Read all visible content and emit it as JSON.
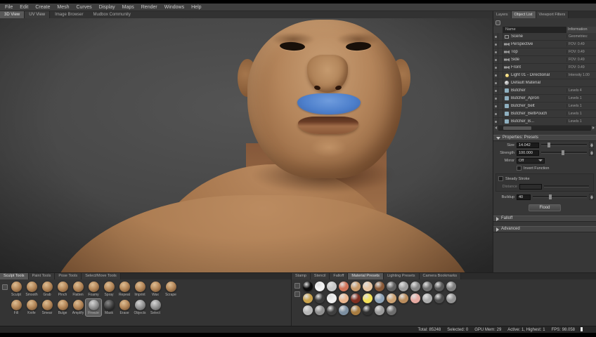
{
  "menu_bar": {
    "items": [
      "File",
      "Edit",
      "Create",
      "Mesh",
      "Curves",
      "Display",
      "Maps",
      "Render",
      "Windows",
      "Help"
    ]
  },
  "view_bar": {
    "tabs": [
      "3D View",
      "UV View"
    ],
    "links": [
      "Image Browser",
      "Mudbox Community"
    ]
  },
  "object_panel": {
    "tabs": [
      "Layers",
      "Object List",
      "Viewport Filters"
    ],
    "active_tab": "Object List",
    "header": {
      "name": "Name",
      "info": "Information"
    },
    "rows": [
      {
        "icon": "scene-icon",
        "name": "Scene",
        "info": "Geometries:"
      },
      {
        "icon": "camera-icon",
        "name": "Perspective",
        "info": "FOV: 0.49"
      },
      {
        "icon": "camera-icon",
        "name": "Top",
        "info": "FOV: 0.49"
      },
      {
        "icon": "camera-icon",
        "name": "Side",
        "info": "FOV: 0.49"
      },
      {
        "icon": "camera-icon",
        "name": "Front",
        "info": "FOV: 0.49"
      },
      {
        "icon": "light-icon",
        "name": "Light 01 - Directional",
        "info": "Intensity 1.00"
      },
      {
        "icon": "material-icon",
        "name": "Default Material",
        "info": ""
      },
      {
        "icon": "mesh-icon",
        "name": "Butcher",
        "info": "Levels 4"
      },
      {
        "icon": "mesh-icon",
        "name": "Butcher_Apron",
        "info": "Levels 1"
      },
      {
        "icon": "mesh-icon",
        "name": "Butcher_belt",
        "info": "Levels 1"
      },
      {
        "icon": "mesh-icon",
        "name": "Butcher_BeltPouch",
        "info": "Levels 1"
      },
      {
        "icon": "mesh-icon",
        "name": "Butcher_B...",
        "info": "Levels 1"
      }
    ]
  },
  "properties": {
    "title": "Properties: Presets",
    "size_label": "Size",
    "size_value": "14.042",
    "strength_label": "Strength",
    "strength_value": "100.000",
    "mirror_label": "Mirror",
    "mirror_value": "Off",
    "invert_label": "Invert Function",
    "steady_label": "Steady Stroke",
    "distance_label": "Distance",
    "distance_value": "",
    "buildup_label": "Buildup",
    "buildup_value": "40",
    "flood_label": "Flood",
    "falloff_label": "Falloff",
    "advanced_label": "Advanced"
  },
  "tool_tray": {
    "tabs": [
      "Sculpt Tools",
      "Paint Tools",
      "Pose Tools",
      "Select/Move Tools"
    ],
    "active_tab": "Sculpt Tools",
    "row1": [
      "Sculpt",
      "Smooth",
      "Grab",
      "Pinch",
      "Flatten",
      "Foamy",
      "Spray",
      "Repeat",
      "Imprint",
      "Wax",
      "Scrape"
    ],
    "row2": [
      "Fill",
      "Knife",
      "Smear",
      "Bulge",
      "Amplify",
      "Freeze",
      "Mask",
      "Erase",
      "Objects",
      "Select"
    ],
    "selected_tool": "Freeze"
  },
  "preset_tray": {
    "tabs": [
      "Stamp",
      "Stencil",
      "Falloff",
      "Material Presets",
      "Lighting Presets",
      "Camera Bookmarks"
    ],
    "active_tab": "Material Presets",
    "swatch_rows": [
      [
        "#0c0c0c",
        "#f2f2f2",
        "#c9c9c9",
        "#cf7258",
        "#c79a6a",
        "#e7c5a3",
        "#8a5a38",
        "#5f5f5f",
        "#9d9d9d",
        "#868686",
        "#707070",
        "#585858",
        "#7e7e7e"
      ],
      [
        "#c9a24c",
        "#3b3b3b",
        "#efefef",
        "#e9b58e",
        "#7e2e20",
        "#f4e159",
        "#8ea3b6",
        "#cba273",
        "#ba8d5d",
        "#e5a9a1",
        "#ababab",
        "#4b4b4b",
        "#929292"
      ],
      [
        "#b6b6b6",
        "#8f8f8f",
        "#404040",
        "#7c8fa1",
        "#a87c40",
        "#303030",
        "#9a9a9a",
        "#6c6c6c"
      ]
    ]
  },
  "status_bar": {
    "total": "Total: 85248",
    "selected": "Selected: 0",
    "gpu": "GPU Mem: 29",
    "active": "Active: 1, Highest: 1",
    "fps": "FPS: 98.058"
  },
  "colors": {
    "accent_paint": "#4e80cc",
    "skin": "#b4855b"
  }
}
